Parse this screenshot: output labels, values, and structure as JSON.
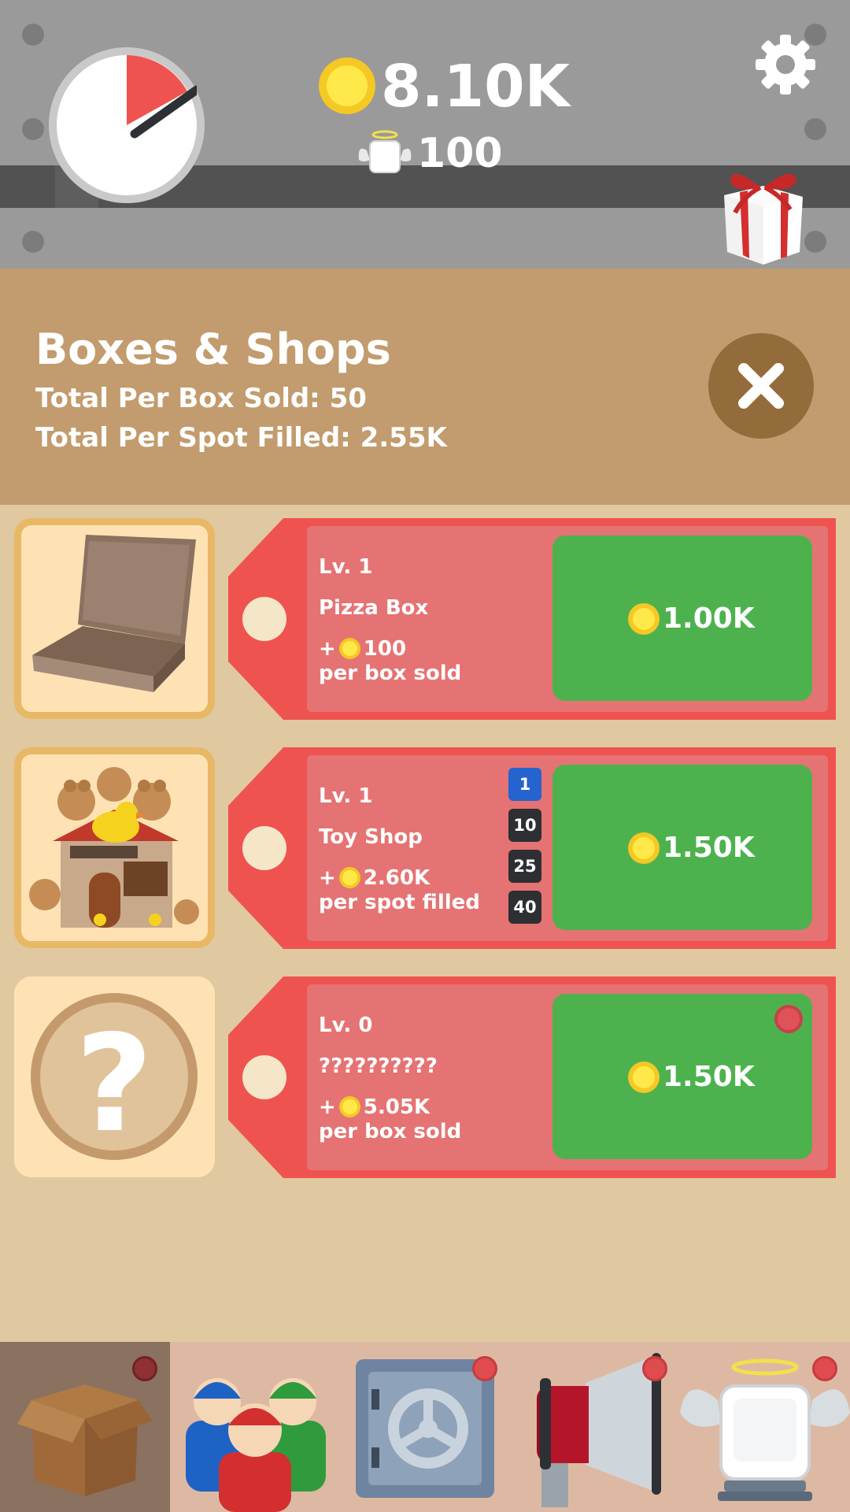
{
  "header": {
    "coins": "8.10K",
    "angels": "100"
  },
  "panel": {
    "title": "Boxes & Shops",
    "total_per_box_sold": "Total Per Box Sold: 50",
    "total_per_spot_filled": "Total Per Spot Filled: 2.55K"
  },
  "items": [
    {
      "level": "Lv. 1",
      "name": "Pizza Box",
      "reward_prefix": "+",
      "reward": "100",
      "reward_unit": "per box sold",
      "price": "1.00K"
    },
    {
      "level": "Lv. 1",
      "name": "Toy Shop",
      "reward_prefix": "+",
      "reward": "2.60K",
      "reward_unit": "per spot filled",
      "price": "1.50K",
      "buy_amounts": [
        "1",
        "10",
        "25",
        "40"
      ],
      "selected_amount": "1"
    },
    {
      "level": "Lv. 0",
      "name": "??????????",
      "reward_prefix": "+",
      "reward": "5.05K",
      "reward_unit": "per box sold",
      "price": "1.50K",
      "locked_symbol": "?"
    }
  ],
  "nav": [
    {
      "icon": "cardboard-box-icon",
      "active": true
    },
    {
      "icon": "workers-icon",
      "active": false
    },
    {
      "icon": "safe-icon",
      "active": false
    },
    {
      "icon": "megaphone-icon",
      "active": false
    },
    {
      "icon": "angel-box-icon",
      "active": false
    }
  ],
  "colors": {
    "accent_green": "#4db24e",
    "tag_red": "#ef5350",
    "panel_tan": "#c29c6e",
    "coin_yellow": "#f5c823",
    "selected_blue": "#2563cf"
  }
}
